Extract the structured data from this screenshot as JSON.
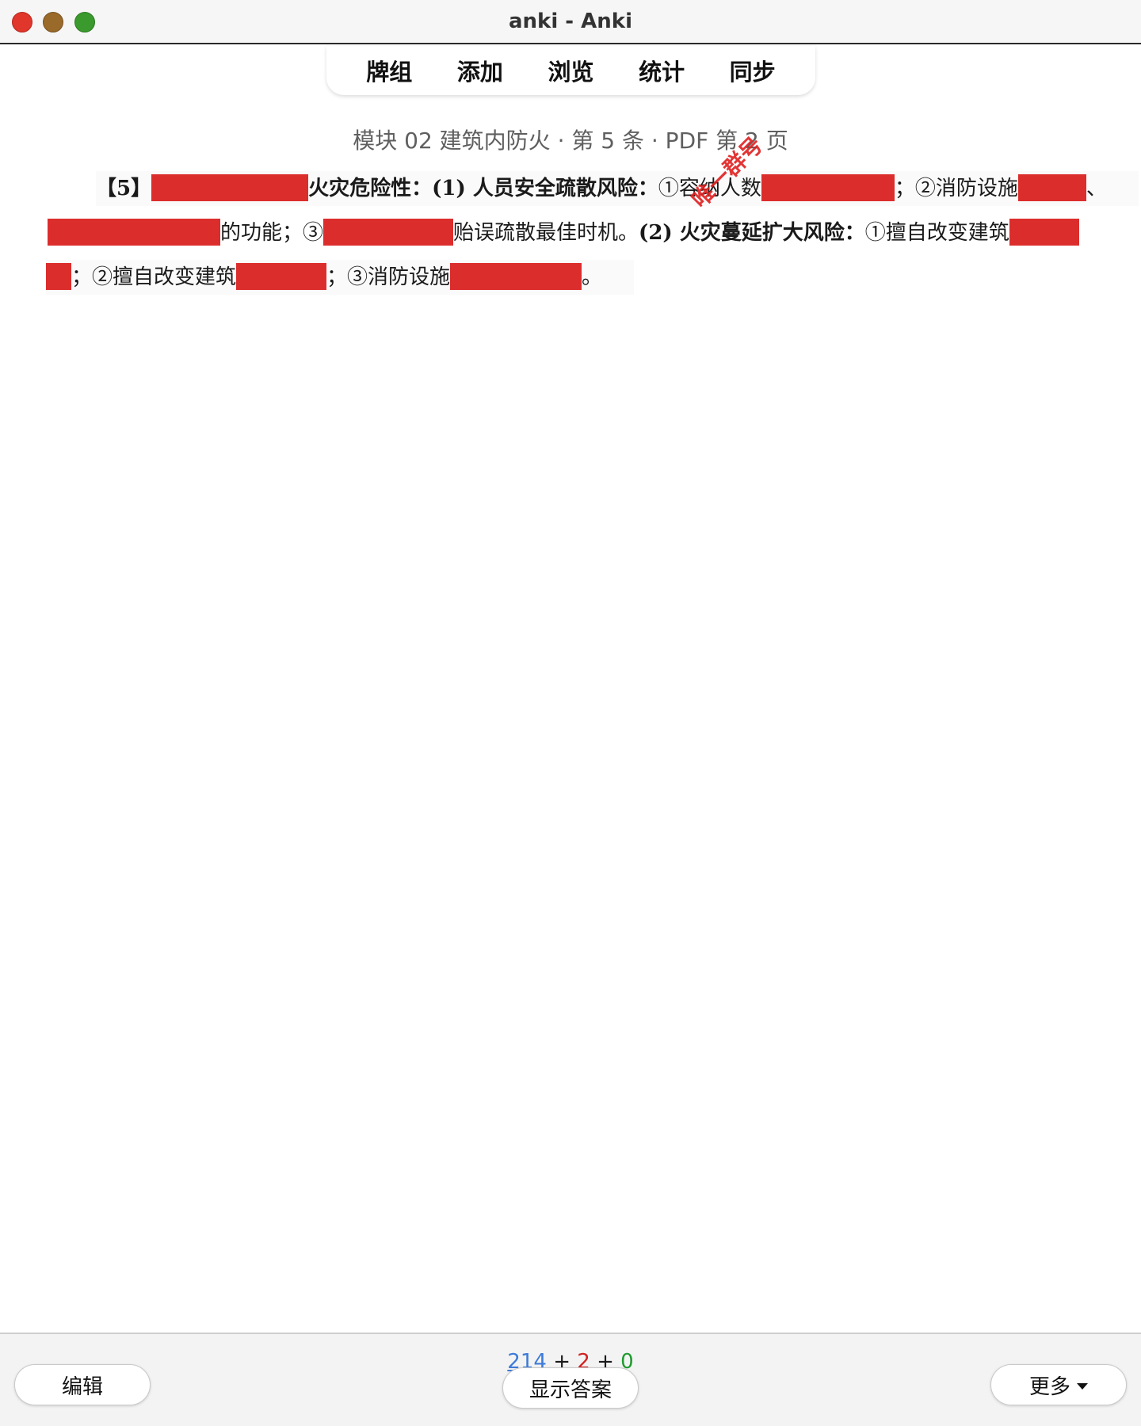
{
  "window": {
    "title": "anki - Anki",
    "controls": [
      "close",
      "minimize",
      "maximize"
    ]
  },
  "toolbar": {
    "items": [
      {
        "label": "牌组"
      },
      {
        "label": "添加"
      },
      {
        "label": "浏览"
      },
      {
        "label": "统计"
      },
      {
        "label": "同步"
      }
    ]
  },
  "card": {
    "source": "模块 02 建筑内防火 · 第 5 条 · PDF 第 2 页",
    "stamp": "唯一群号",
    "line1": {
      "s1": "【5】",
      "s2": "火灾危险性：(1) 人员安全疏散风险：",
      "s3": "①容纳",
      "s4": "人数",
      "s5": "；②消防设施",
      "s6": "、"
    },
    "line2": {
      "s1": "的功能；③",
      "s2": "贻误疏散最佳时机。",
      "s3": "(2) 火灾蔓延扩大风险：",
      "s4": "①擅自改变建筑"
    },
    "line3": {
      "s1": "；②擅自改变建筑",
      "s2": "；③消防设施",
      "s3": "。"
    },
    "occlusion_color": "#dc2d2d"
  },
  "bottom": {
    "counts": {
      "new": "214",
      "learn": "2",
      "review": "0",
      "plus": "+"
    },
    "edit_label": "编辑",
    "show_answer_label": "显示答案",
    "more_label": "更多"
  }
}
